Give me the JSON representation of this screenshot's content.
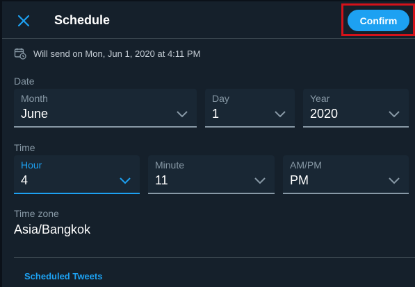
{
  "header": {
    "title": "Schedule",
    "confirm_label": "Confirm"
  },
  "send_info": "Will send on Mon, Jun 1, 2020 at 4:11 PM",
  "date": {
    "section_label": "Date",
    "month": {
      "label": "Month",
      "value": "June"
    },
    "day": {
      "label": "Day",
      "value": "1"
    },
    "year": {
      "label": "Year",
      "value": "2020"
    }
  },
  "time": {
    "section_label": "Time",
    "hour": {
      "label": "Hour",
      "value": "4"
    },
    "minute": {
      "label": "Minute",
      "value": "11"
    },
    "ampm": {
      "label": "AM/PM",
      "value": "PM"
    }
  },
  "timezone": {
    "label": "Time zone",
    "value": "Asia/Bangkok"
  },
  "footer": {
    "scheduled_link": "Scheduled Tweets"
  },
  "colors": {
    "background": "#15202b",
    "field_bg": "#192734",
    "accent": "#1da1f2",
    "muted_text": "#8899a6",
    "highlight_box": "#d4121a"
  }
}
